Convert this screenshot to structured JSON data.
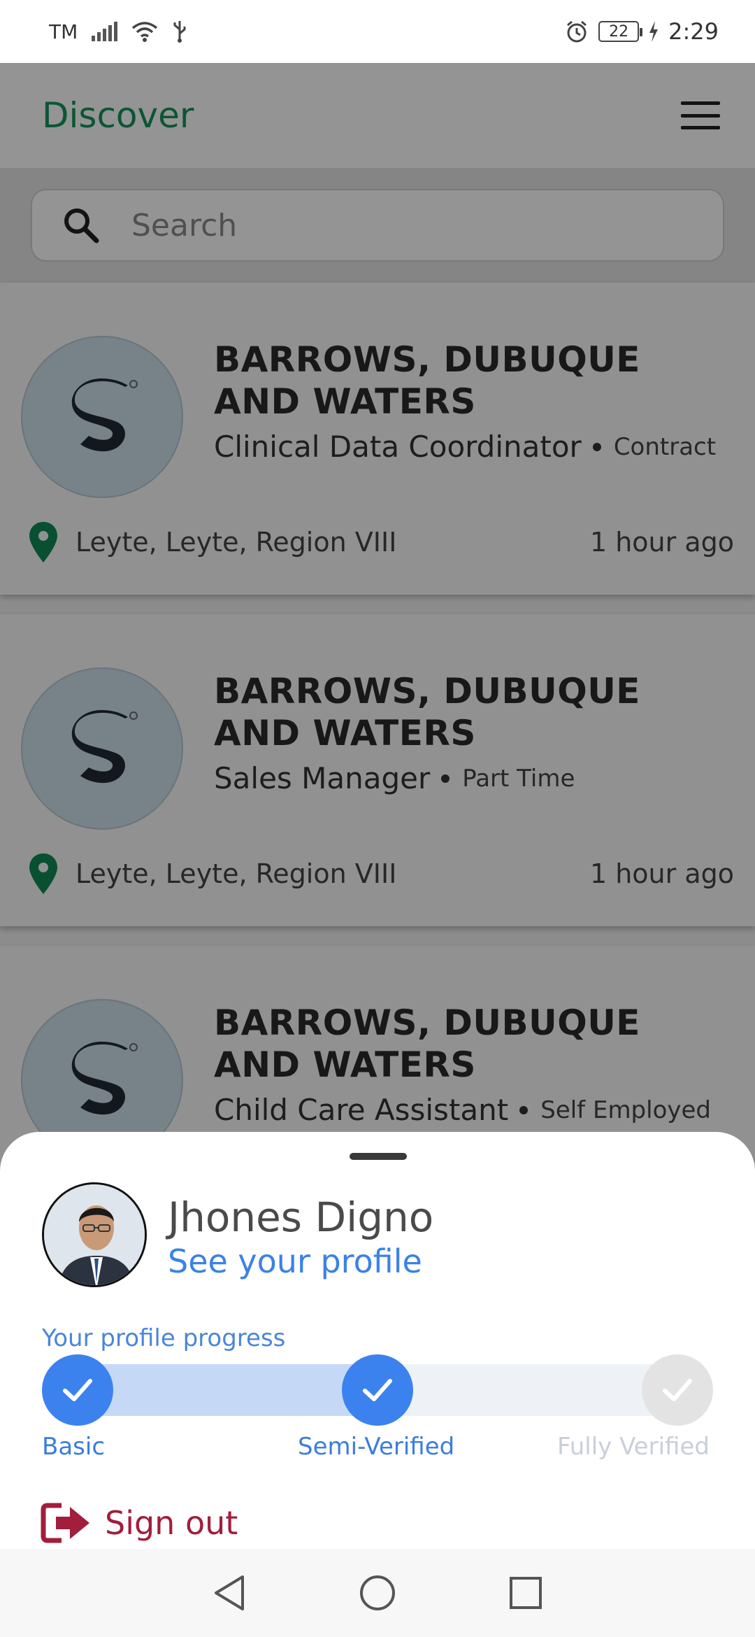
{
  "status_bar": {
    "carrier": "TM",
    "battery_level": "22",
    "time": "2:29"
  },
  "header": {
    "title": "Discover",
    "menu_icon": "hamburger-menu-icon"
  },
  "search": {
    "placeholder": "Search",
    "icon": "search-icon"
  },
  "jobs": [
    {
      "company": "BARROWS, DUBUQUE AND WATERS",
      "role": "Clinical Data Coordinator",
      "type": "Contract",
      "location": "Leyte, Leyte, Region VIII",
      "posted": "1 hour ago"
    },
    {
      "company": "BARROWS, DUBUQUE AND WATERS",
      "role": "Sales Manager",
      "type": "Part Time",
      "location": "Leyte, Leyte, Region VIII",
      "posted": "1 hour ago"
    },
    {
      "company": "BARROWS, DUBUQUE AND WATERS",
      "role": "Child Care Assistant",
      "type": "Self Employed",
      "location": "",
      "posted": ""
    }
  ],
  "profile_sheet": {
    "user_name": "Jhones Digno",
    "see_profile": "See your profile",
    "progress_label": "Your profile progress",
    "steps": [
      {
        "label": "Basic",
        "completed": true
      },
      {
        "label": "Semi-Verified",
        "completed": true
      },
      {
        "label": "Fully Verified",
        "completed": false
      }
    ],
    "progress_fraction": 0.5,
    "sign_out": "Sign out"
  },
  "colors": {
    "brand_green": "#13955a",
    "accent_blue": "#3c82ef",
    "sign_out_red": "#a31d3c"
  }
}
